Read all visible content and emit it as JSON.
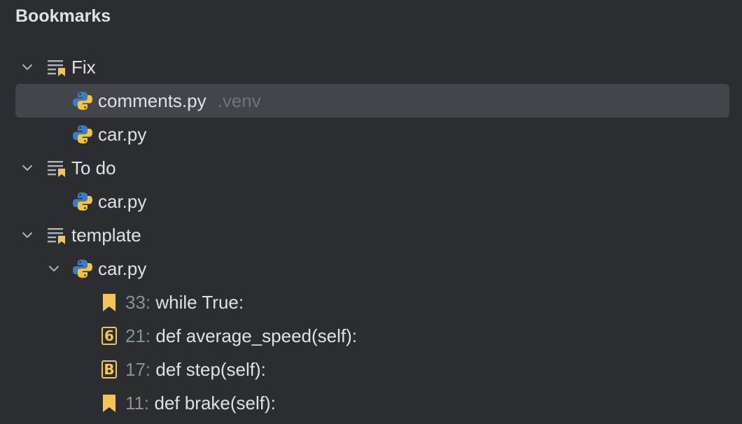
{
  "panel": {
    "title": "Bookmarks"
  },
  "groups": [
    {
      "name": "Fix",
      "files": [
        {
          "name": "comments.py",
          "hint": ".venv",
          "selected": true
        },
        {
          "name": "car.py"
        }
      ]
    },
    {
      "name": "To do",
      "files": [
        {
          "name": "car.py"
        }
      ]
    },
    {
      "name": "template",
      "files": [
        {
          "name": "car.py",
          "bookmarks": [
            {
              "type": "bookmark",
              "line": "33:",
              "code": "while True:"
            },
            {
              "type": "mnemonic",
              "mnemonic": "6",
              "line": "21:",
              "code": "def average_speed(self):"
            },
            {
              "type": "mnemonic",
              "mnemonic": "B",
              "line": "17:",
              "code": "def step(self):"
            },
            {
              "type": "bookmark",
              "line": "11:",
              "code": "def brake(self):"
            }
          ]
        }
      ]
    }
  ],
  "icons": {
    "group": "bookmark-list-icon",
    "file": "python-file-icon",
    "chevron": "chevron-down-icon",
    "bookmark": "bookmark-flag-icon"
  },
  "colors": {
    "background": "#2b2d30",
    "selection": "#43454a",
    "text": "#dfe1e5",
    "muted": "#6f737a",
    "bookmark": "#f2c55c"
  }
}
